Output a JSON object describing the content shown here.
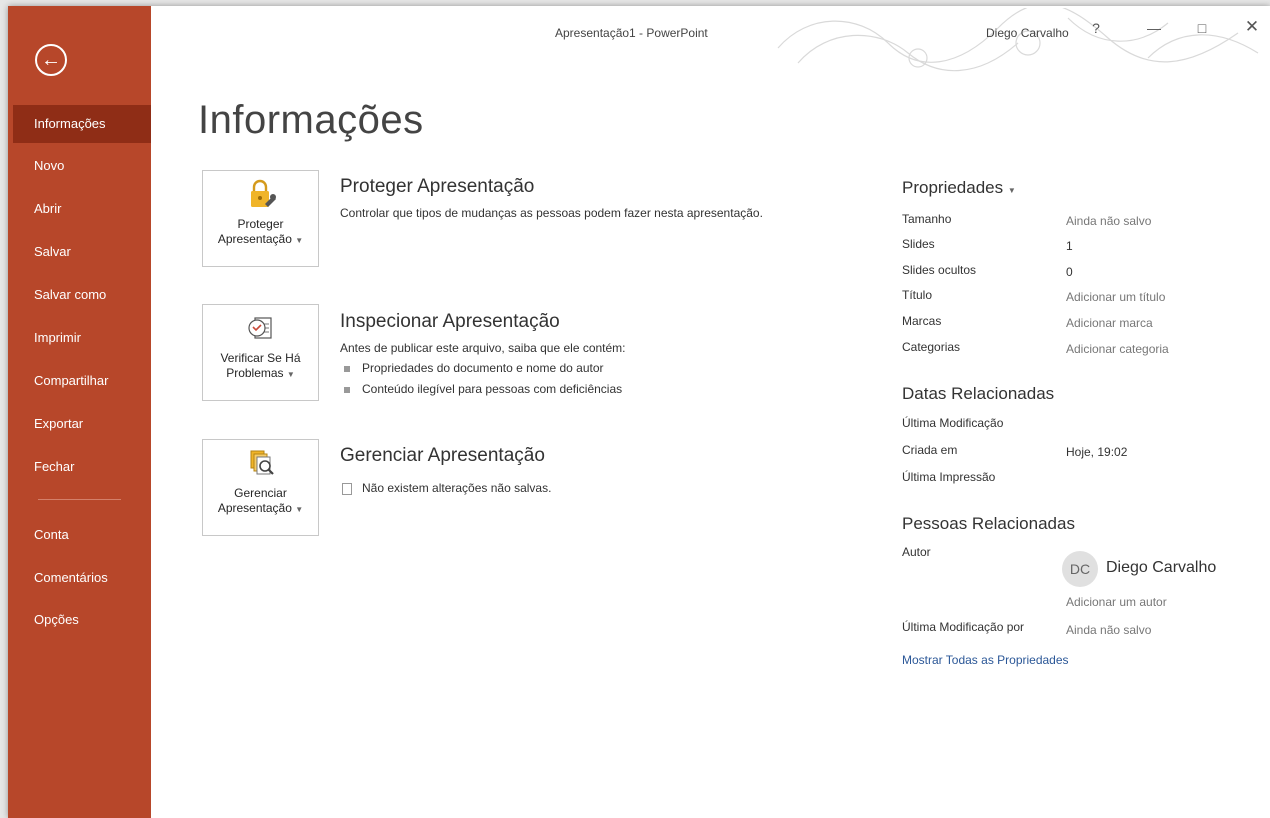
{
  "window": {
    "title": "Apresentação1  -  PowerPoint",
    "user": "Diego Carvalho",
    "help": "?"
  },
  "icons": {
    "back": "back-arrow-icon",
    "help": "help-icon",
    "minimize": "minimize-icon",
    "maximize": "maximize-icon",
    "close": "close-icon",
    "lock": "lock-key-icon",
    "inspect": "inspect-document-icon",
    "manage": "manage-versions-icon",
    "doc": "document-icon"
  },
  "colors": {
    "sidebar": "#b7472a",
    "sidebar_active": "#8f2d16",
    "link": "#2b5797"
  },
  "sidebar": {
    "items": [
      {
        "label": "Informações",
        "active": true
      },
      {
        "label": "Novo"
      },
      {
        "label": "Abrir"
      },
      {
        "label": "Salvar"
      },
      {
        "label": "Salvar como"
      },
      {
        "label": "Imprimir"
      },
      {
        "label": "Compartilhar"
      },
      {
        "label": "Exportar"
      },
      {
        "label": "Fechar"
      },
      {
        "label": "Conta"
      },
      {
        "label": "Comentários"
      },
      {
        "label": "Opções"
      }
    ]
  },
  "main": {
    "title": "Informações",
    "protect": {
      "button_line1": "Proteger",
      "button_line2": "Apresentação",
      "title": "Proteger Apresentação",
      "desc": "Controlar que tipos de mudanças as pessoas podem fazer nesta apresentação."
    },
    "inspect": {
      "button_line1": "Verificar Se Há",
      "button_line2": "Problemas",
      "title": "Inspecionar Apresentação",
      "desc": "Antes de publicar este arquivo, saiba que ele contém:",
      "bullets": [
        "Propriedades do documento e nome do autor",
        "Conteúdo ilegível para pessoas com deficiências"
      ]
    },
    "manage": {
      "button_line1": "Gerenciar",
      "button_line2": "Apresentação",
      "title": "Gerenciar Apresentação",
      "desc": "Não existem alterações não salvas."
    }
  },
  "properties": {
    "title": "Propriedades",
    "rows": [
      {
        "label": "Tamanho",
        "value": "Ainda não salvo"
      },
      {
        "label": "Slides",
        "value": "1"
      },
      {
        "label": "Slides ocultos",
        "value": "0"
      },
      {
        "label": "Título",
        "value": "Adicionar um título"
      },
      {
        "label": "Marcas",
        "value": "Adicionar marca"
      },
      {
        "label": "Categorias",
        "value": "Adicionar categoria"
      }
    ],
    "dates_title": "Datas Relacionadas",
    "dates": [
      {
        "label": "Última Modificação",
        "value": ""
      },
      {
        "label": "Criada em",
        "value": "Hoje, 19:02"
      },
      {
        "label": "Última Impressão",
        "value": ""
      }
    ],
    "people_title": "Pessoas Relacionadas",
    "author_label": "Autor",
    "author_initials": "DC",
    "author_name": "Diego Carvalho",
    "add_author": "Adicionar um autor",
    "modified_by_label": "Última Modificação por",
    "modified_by_value": "Ainda não salvo",
    "show_all": "Mostrar Todas as Propriedades"
  }
}
